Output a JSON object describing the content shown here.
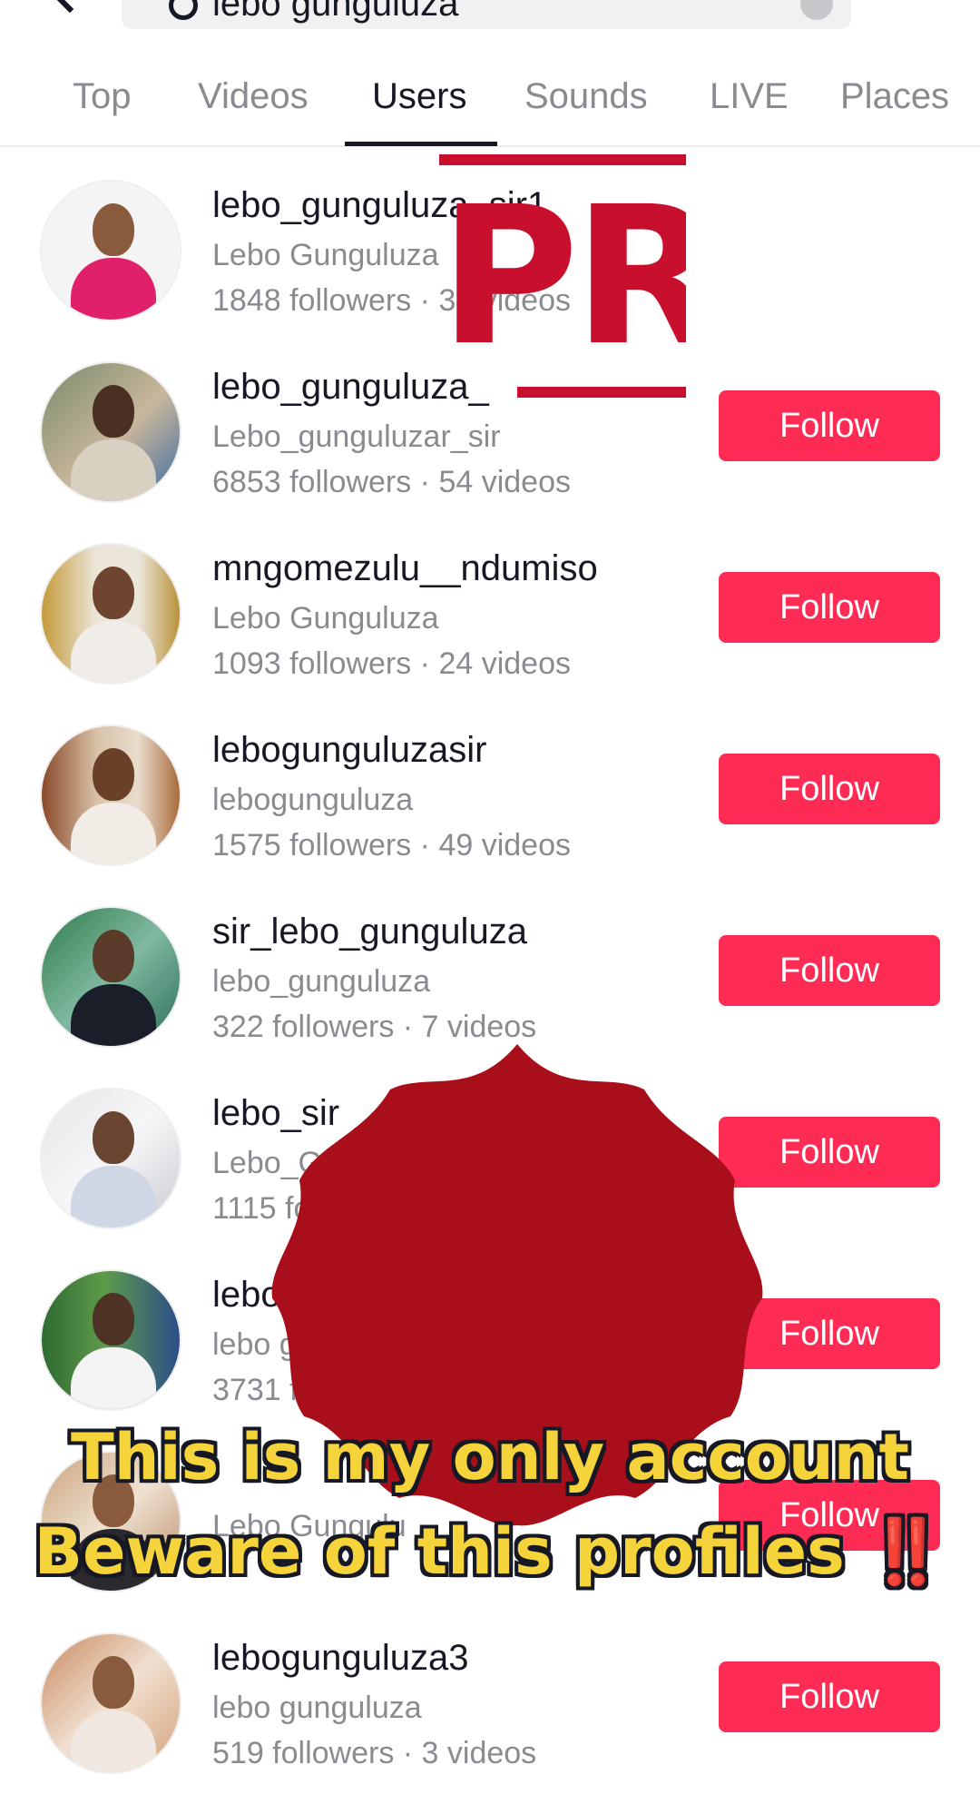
{
  "search": {
    "query": "lebo gunguluza"
  },
  "tabs": [
    {
      "label": "Top"
    },
    {
      "label": "Videos"
    },
    {
      "label": "Users"
    },
    {
      "label": "Sounds"
    },
    {
      "label": "LIVE"
    },
    {
      "label": "Places"
    }
  ],
  "active_tab": "Users",
  "users": [
    {
      "username": "lebo_gunguluza_sir1",
      "nickname": "Lebo Gunguluza",
      "stats": "1848 followers · 34 videos",
      "follow": ""
    },
    {
      "username": "lebo_gunguluza_",
      "nickname": "Lebo_gunguluzar_sir",
      "stats": "6853 followers · 54 videos",
      "follow": "Follow"
    },
    {
      "username": "mngomezulu__ndumiso",
      "nickname": "Lebo Gunguluza",
      "stats": "1093 followers · 24 videos",
      "follow": "Follow"
    },
    {
      "username": "lebogunguluzasir",
      "nickname": "lebogunguluza",
      "stats": "1575 followers · 49 videos",
      "follow": "Follow"
    },
    {
      "username": "sir_lebo_gunguluza",
      "nickname": "lebo_gunguluza",
      "stats": "322 followers · 7 videos",
      "follow": "Follow"
    },
    {
      "username": "lebo_sir",
      "nickname": "Lebo_G",
      "stats": "1115 fo",
      "follow": "Follow"
    },
    {
      "username": "lebo",
      "nickname": "lebo g",
      "stats": "3731 f",
      "follow": "Follow"
    },
    {
      "username": "",
      "nickname": "Lebo Gungulu",
      "stats": "",
      "follow": "Follow"
    },
    {
      "username": "lebogunguluza3",
      "nickname": "lebo gunguluza",
      "stats": "519 followers · 3 videos",
      "follow": "Follow"
    }
  ],
  "overlay": {
    "stamp_text": "PROI",
    "caption_line1": "This is my only account",
    "caption_line2": "Beware of this profiles",
    "caption_emoji": "‼️"
  },
  "colors": {
    "follow_bg": "#fe2c55",
    "caption_text": "#f5d33a",
    "stamp_red": "#c8102e",
    "seal_red": "#a80f1a"
  }
}
